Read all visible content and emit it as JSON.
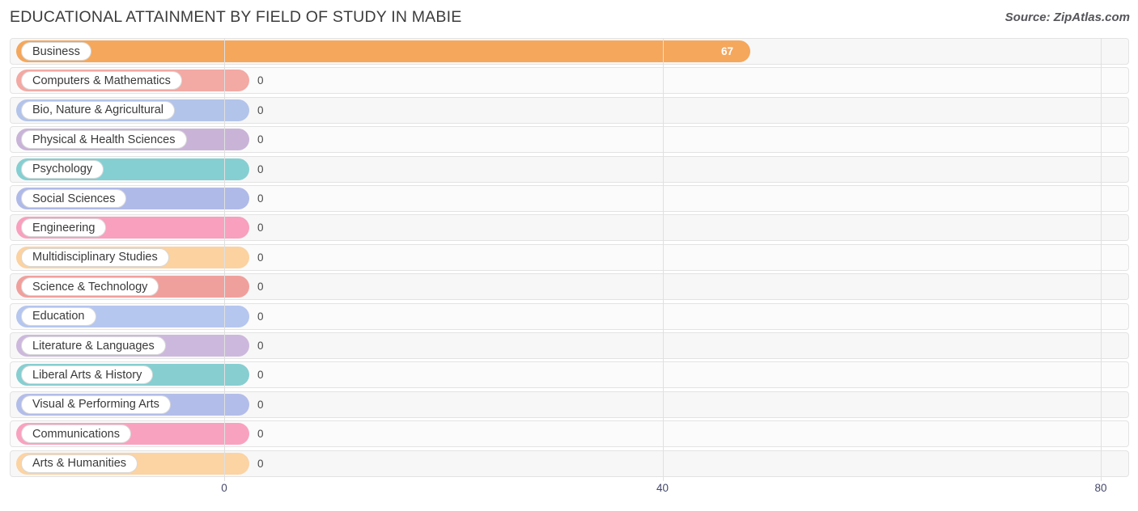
{
  "header": {
    "title": "EDUCATIONAL ATTAINMENT BY FIELD OF STUDY IN MABIE",
    "source": "Source: ZipAtlas.com"
  },
  "chart_data": {
    "type": "bar",
    "orientation": "horizontal",
    "title": "EDUCATIONAL ATTAINMENT BY FIELD OF STUDY IN MABIE",
    "xlabel": "",
    "ylabel": "",
    "xlim": [
      0,
      80
    ],
    "xticks": [
      "0",
      "40",
      "80"
    ],
    "grid": true,
    "legend": false,
    "categories": [
      "Business",
      "Computers & Mathematics",
      "Bio, Nature & Agricultural",
      "Physical & Health Sciences",
      "Psychology",
      "Social Sciences",
      "Engineering",
      "Multidisciplinary Studies",
      "Science & Technology",
      "Education",
      "Literature & Languages",
      "Liberal Arts & History",
      "Visual & Performing Arts",
      "Communications",
      "Arts & Humanities"
    ],
    "values": [
      67,
      0,
      0,
      0,
      0,
      0,
      0,
      0,
      0,
      0,
      0,
      0,
      0,
      0,
      0
    ],
    "value_labels": [
      "67",
      "0",
      "0",
      "0",
      "0",
      "0",
      "0",
      "0",
      "0",
      "0",
      "0",
      "0",
      "0",
      "0",
      "0"
    ],
    "colors": [
      "#f5a75c",
      "#f3a9a4",
      "#b3c4ea",
      "#c9b4d8",
      "#85cfd2",
      "#b0bae8",
      "#f8a0bd",
      "#fbd2a0",
      "#f0a09c",
      "#b5c6ef",
      "#cdb8dd",
      "#87ced1",
      "#b3bde9",
      "#f9a2bf",
      "#fcd3a2"
    ]
  }
}
